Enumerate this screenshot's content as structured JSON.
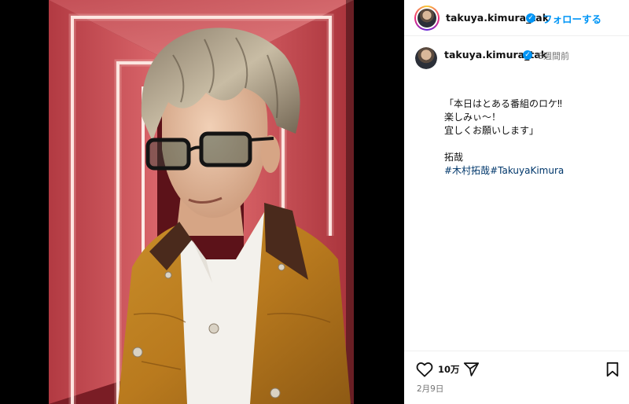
{
  "post": {
    "username": "takuya.kimura_tak",
    "follow_label": "フォローする",
    "more_label": "•••",
    "time_ago": "8週間前",
    "caption_lines": [
      "「本日はとある番組のロケ‼",
      "楽しみぃ〜！",
      "宜しくお願いします」"
    ],
    "signature": "拓哉",
    "hashtags": [
      "#木村拓哉",
      "#TakuyaKimura"
    ],
    "likes": "10万",
    "date": "2月9日"
  },
  "colors": {
    "link_blue": "#0095f6",
    "hashtag": "#00376b",
    "verified": "#0095f6",
    "muted": "#737373"
  },
  "icons": {
    "verified": "verified-badge-icon",
    "heart": "heart-icon",
    "share": "share-icon",
    "save": "bookmark-icon"
  }
}
